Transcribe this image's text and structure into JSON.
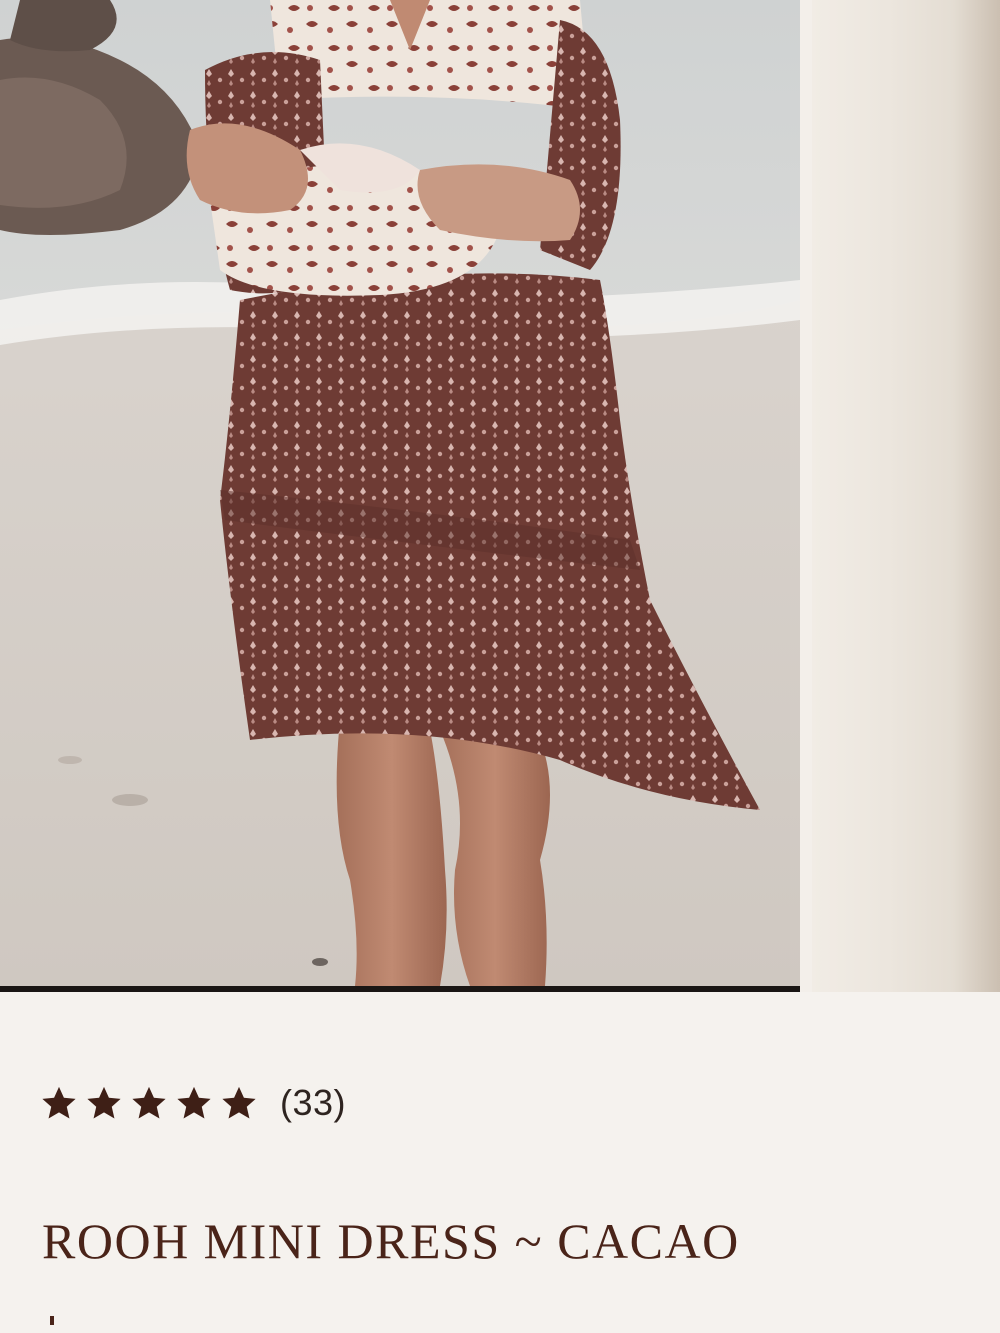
{
  "gallery": {
    "main_image_alt": "Model on beach wearing printed mini dress",
    "next_image_alt": "Next product image"
  },
  "rating": {
    "stars": 5,
    "max_stars": 5,
    "count_label": "(33)",
    "star_color": "#3e1f16"
  },
  "product": {
    "title": "ROOH MINI DRESS ~ CACAO",
    "title_color": "#4a2419"
  }
}
